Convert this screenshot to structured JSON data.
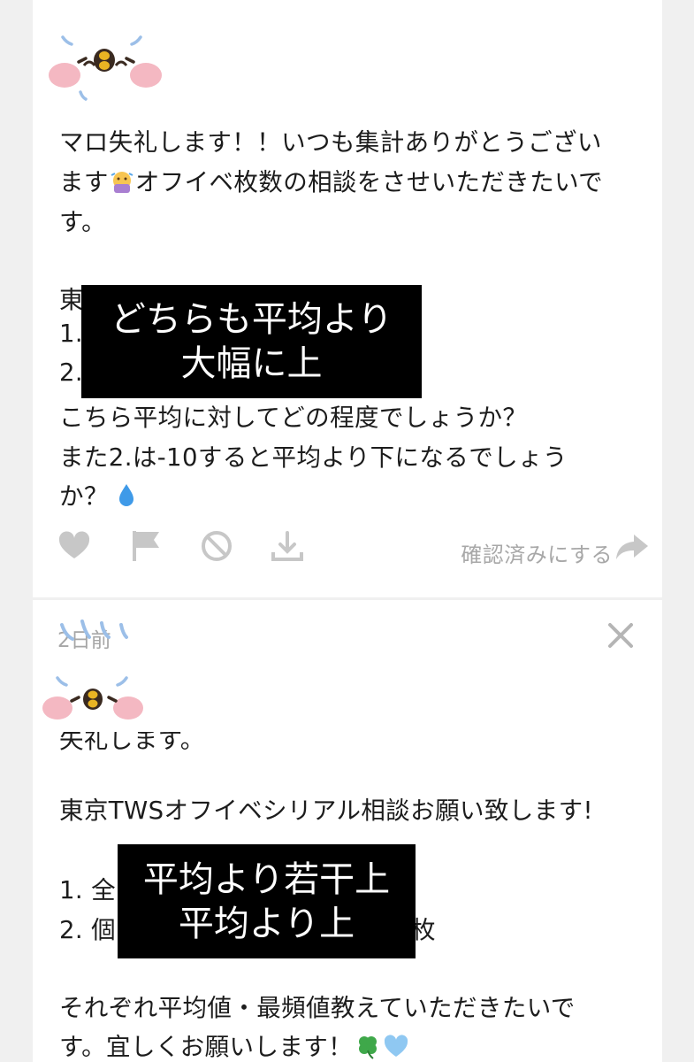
{
  "colors": {
    "background": "#f0f0f0",
    "card": "#ffffff",
    "text": "#1c1c1c",
    "muted": "#a8a8a8",
    "icon": "#c7c7c7",
    "censor": "#000000",
    "mascot_blue": "#9cbfe8",
    "mascot_pink": "#f4b8c2",
    "mascot_beak": "#e9b423"
  },
  "icons": {
    "heart": "heart-icon",
    "flag": "flag-icon",
    "block": "block-icon",
    "download": "download-icon",
    "share": "share-arrow-icon",
    "close": "close-icon",
    "worried": "worried-face-emoji",
    "droplet": "droplet-emoji",
    "clover": "four-leaf-clover-emoji",
    "heart_blue": "blue-heart-emoji"
  },
  "message1": {
    "line1": "マロ失礼します！！いつも集計ありがとうござい",
    "line2_start": "ます",
    "line2_end": "オフイベ枚数の相談をさせいただきたいで",
    "line3": "す。",
    "line4": "東京",
    "line5": "1.",
    "line6": "2.",
    "line7": "こちら平均に対してどの程度でしょうか？",
    "line8": "また2.は-10すると平均より下になるでしょう",
    "line9": "か？",
    "censor_line1": "どちらも平均より",
    "censor_line2": "大幅に上"
  },
  "actions": {
    "confirm_label": "確認済みにする"
  },
  "message2": {
    "timestamp": "2日前",
    "line1": "失礼します。",
    "line2": "東京TWSオフイベシリアル相談お願い致します!",
    "line3": "1. 全",
    "line4_start": "2. 個",
    "line4_end": "枚",
    "line5": "それぞれ平均値・最頻値教えていただきたいで",
    "line6": "す。宜しくお願いします！",
    "censor_line1": "平均より若干上",
    "censor_line2": "平均より上"
  }
}
